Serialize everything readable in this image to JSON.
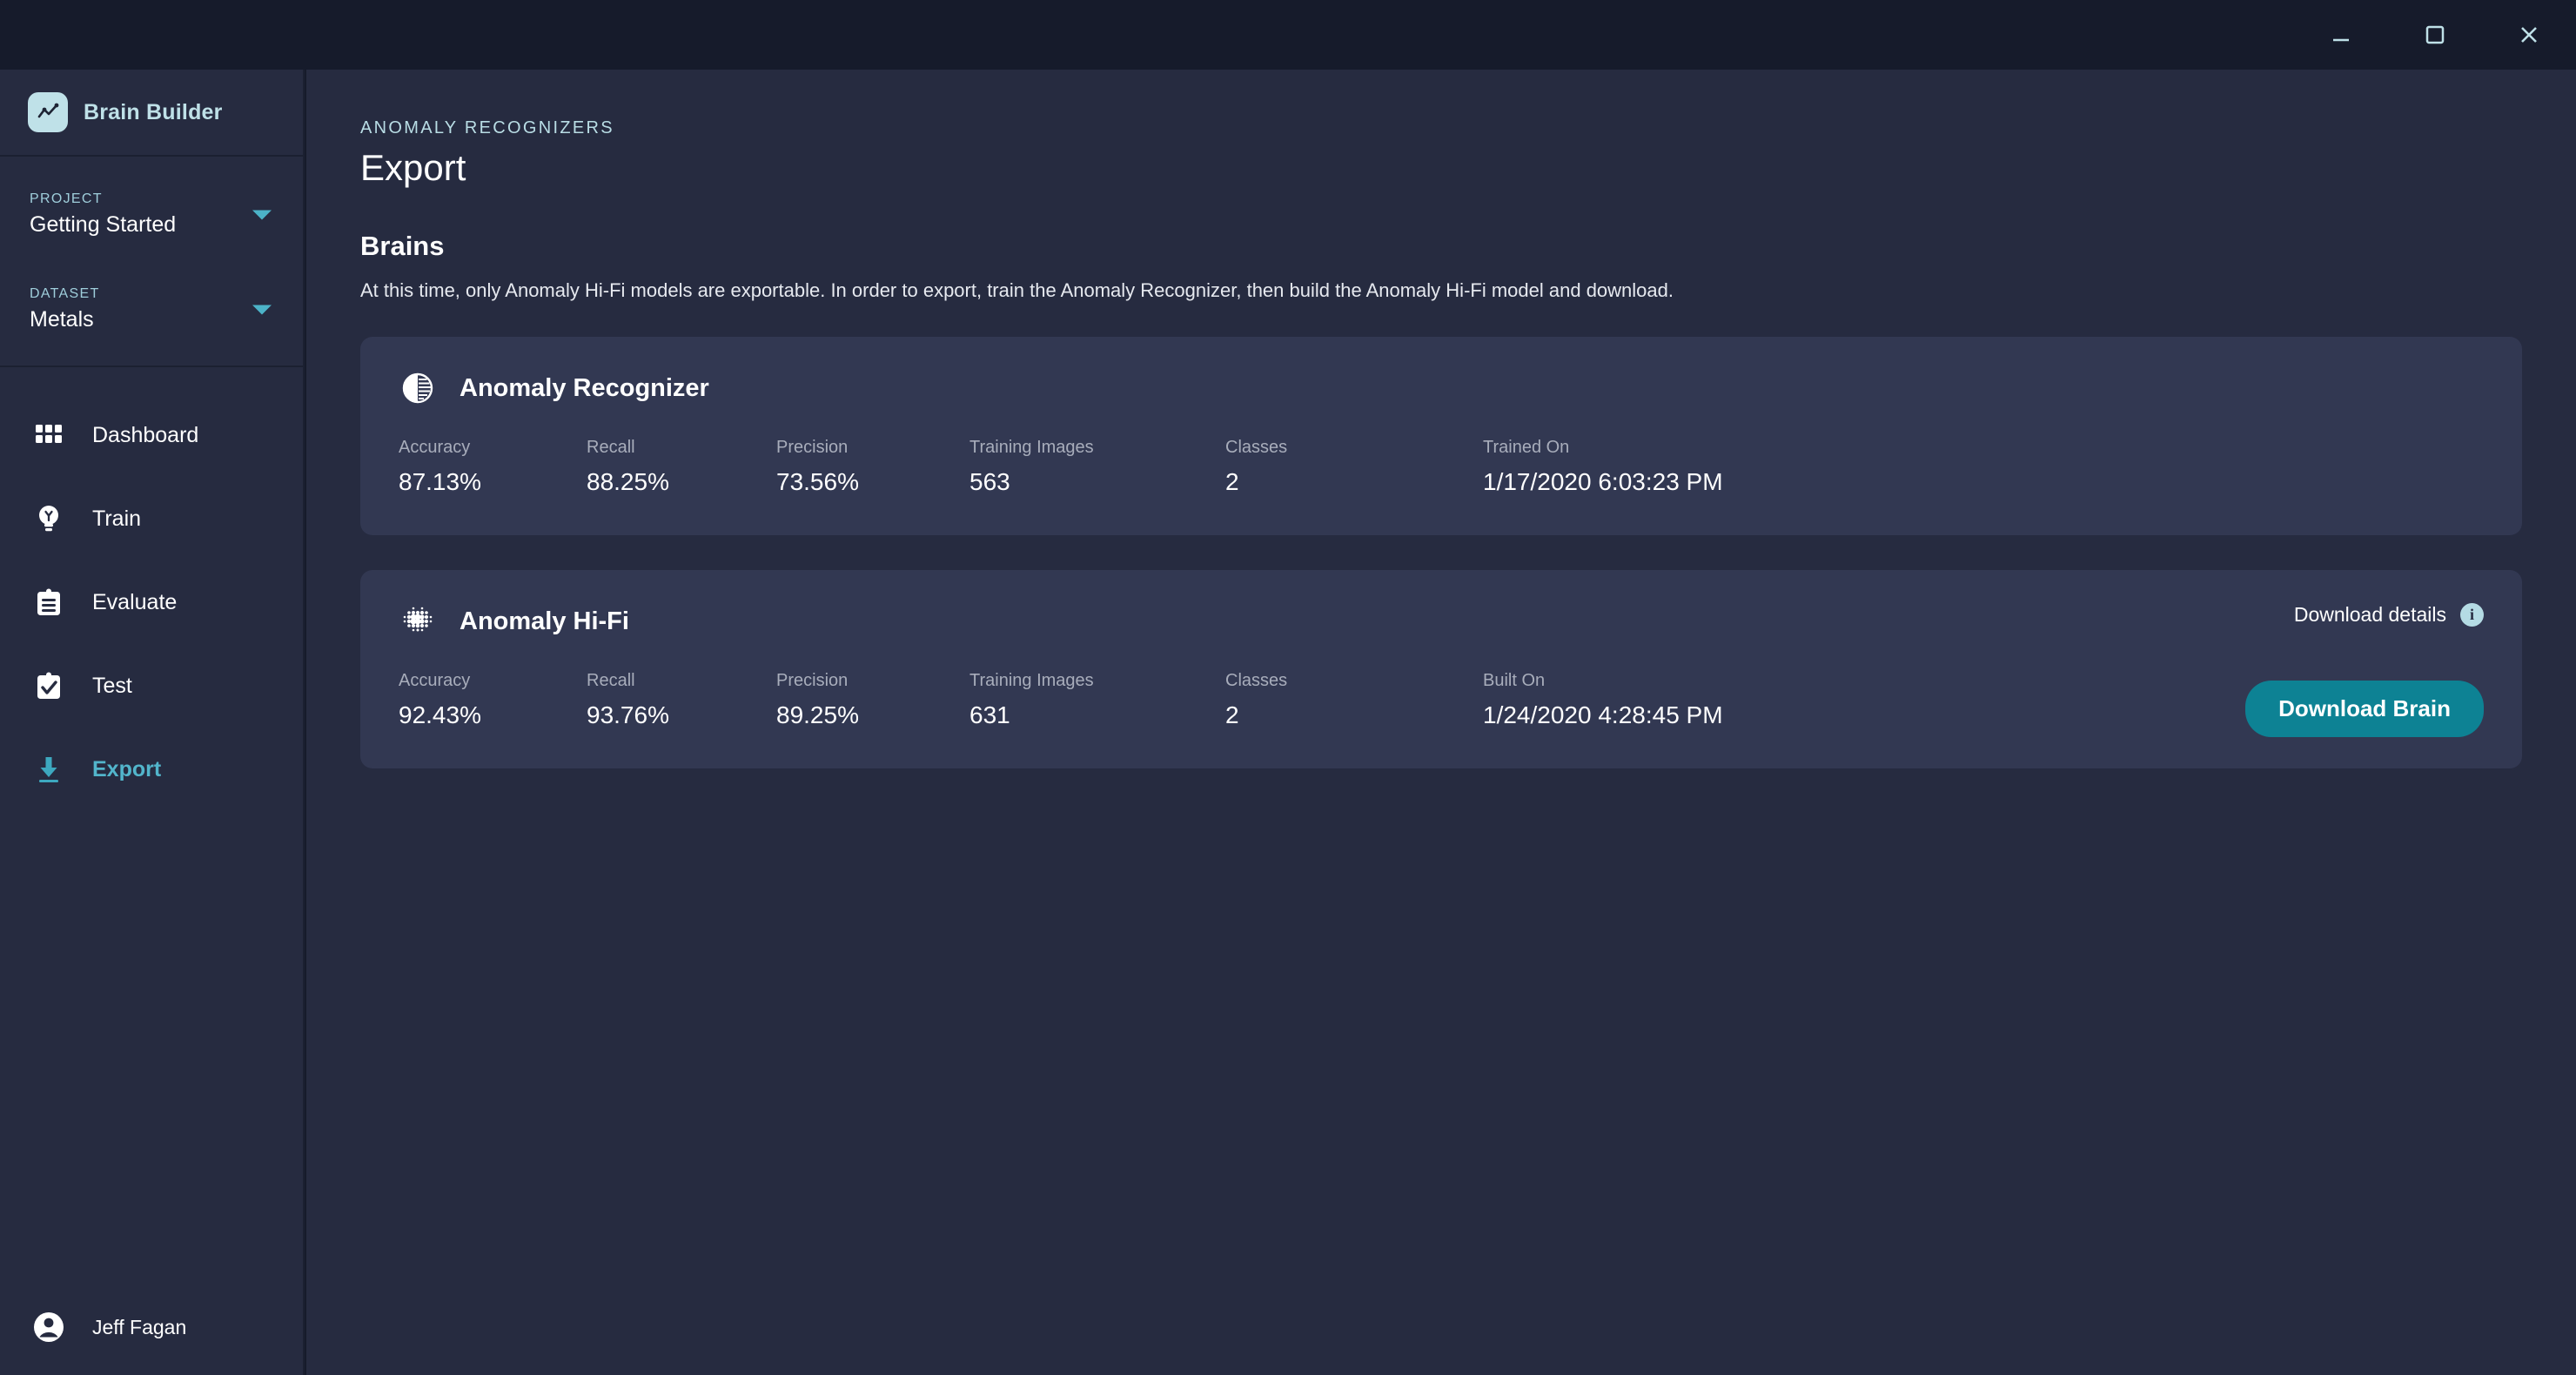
{
  "window": {
    "minimize_label": "minimize",
    "maximize_label": "maximize",
    "close_label": "close"
  },
  "sidebar": {
    "brand": "Brain Builder",
    "selectors": [
      {
        "label": "PROJECT",
        "value": "Getting Started"
      },
      {
        "label": "DATASET",
        "value": "Metals"
      }
    ],
    "nav": [
      {
        "label": "Dashboard",
        "icon": "grid-icon",
        "active": false
      },
      {
        "label": "Train",
        "icon": "lightbulb-icon",
        "active": false
      },
      {
        "label": "Evaluate",
        "icon": "clipboard-icon",
        "active": false
      },
      {
        "label": "Test",
        "icon": "clipboard-check-icon",
        "active": false
      },
      {
        "label": "Export",
        "icon": "download-icon",
        "active": true
      }
    ],
    "user": {
      "name": "Jeff Fagan"
    }
  },
  "main": {
    "eyebrow": "ANOMALY RECOGNIZERS",
    "title": "Export",
    "section_title": "Brains",
    "section_desc": "At this time, only Anomaly Hi-Fi models are exportable. In order to export, train the Anomaly Recognizer, then build the Anomaly Hi-Fi model and download.",
    "cards": [
      {
        "icon": "contrast-circle-icon",
        "title": "Anomaly Recognizer",
        "metrics": [
          {
            "label": "Accuracy",
            "value": "87.13%"
          },
          {
            "label": "Recall",
            "value": "88.25%"
          },
          {
            "label": "Precision",
            "value": "73.56%"
          },
          {
            "label": "Training Images",
            "value": "563"
          },
          {
            "label": "Classes",
            "value": "2"
          },
          {
            "label": "Trained On",
            "value": "1/17/2020 6:03:23 PM"
          }
        ]
      },
      {
        "icon": "dot-matrix-icon",
        "title": "Anomaly Hi-Fi",
        "download_details_label": "Download details",
        "download_button_label": "Download Brain",
        "metrics": [
          {
            "label": "Accuracy",
            "value": "92.43%"
          },
          {
            "label": "Recall",
            "value": "93.76%"
          },
          {
            "label": "Precision",
            "value": "89.25%"
          },
          {
            "label": "Training Images",
            "value": "631"
          },
          {
            "label": "Classes",
            "value": "2"
          },
          {
            "label": "Built On",
            "value": "1/24/2020 4:28:45 PM"
          }
        ]
      }
    ]
  },
  "colors": {
    "titlebar_bg": "#161b2b",
    "sidebar_bg": "#262b40",
    "card_bg": "#323852",
    "accent": "#52b5cb",
    "brand_light": "#bfe1e8",
    "button_teal": "#0d8294"
  }
}
